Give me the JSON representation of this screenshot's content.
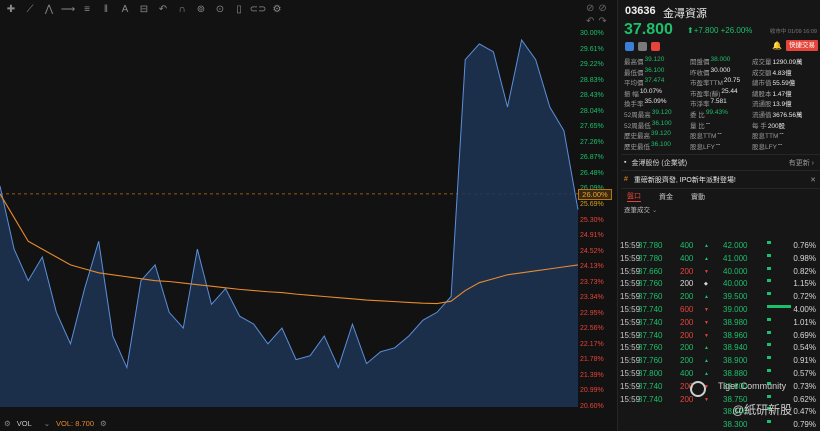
{
  "chart": {
    "y_ticks": [
      "30.00%",
      "29.61%",
      "29.22%",
      "28.83%",
      "28.43%",
      "28.04%",
      "27.65%",
      "27.26%",
      "26.87%",
      "26.48%",
      "26.09%",
      "25.69%",
      "25.30%",
      "24.91%",
      "24.52%",
      "24.13%",
      "23.73%",
      "23.34%",
      "22.95%",
      "22.56%",
      "22.17%",
      "21.78%",
      "21.39%",
      "20.99%",
      "20.60%"
    ],
    "prev_close_tag": "26.00%",
    "vol_label": "VOL",
    "vol_value": "VOL: 8.700",
    "price_line_color": "#5b8fd9",
    "avg_line_color": "#e88a2e"
  },
  "chart_data": {
    "type": "line",
    "series": [
      {
        "name": "",
        "color": "#5b8fd9",
        "values": [
          26.2,
          24.6,
          23.8,
          24.4,
          23.0,
          22.2,
          23.6,
          24.8,
          22.4,
          21.6,
          23.8,
          24.2,
          23.0,
          22.6,
          24.6,
          23.2,
          23.6,
          22.9,
          22.7,
          22.2,
          22.6,
          21.8,
          21.9,
          22.4,
          21.6,
          22.7,
          21.7,
          22.0,
          22.1,
          22.4,
          22.8,
          23.0,
          23.4,
          29.4,
          29.8,
          29.6,
          28.2,
          29.9,
          29.4,
          28.2,
          27.6,
          25.6
        ]
      },
      {
        "name": "",
        "color": "#e88a2e",
        "values": [
          26.0,
          25.4,
          24.8,
          24.6,
          24.4,
          24.2,
          24.1,
          24.0,
          23.95,
          23.9,
          23.85,
          23.8,
          23.78,
          23.74,
          23.7,
          23.66,
          23.62,
          23.58,
          23.55,
          23.52,
          23.5,
          23.46,
          23.43,
          23.4,
          23.37,
          23.34,
          23.31,
          23.29,
          23.27,
          23.25,
          23.23,
          23.22,
          23.28,
          23.55,
          23.75,
          23.85,
          23.95,
          24.0,
          24.05,
          24.1,
          24.15,
          24.2
        ]
      }
    ],
    "ylim": [
      20.6,
      30.0
    ],
    "reference_line": 26.0
  },
  "stock": {
    "code": "03636",
    "name": "金潯資源",
    "price": "37.800",
    "change": "+7.800 +26.00%",
    "time": "收市中 01/09 16:09"
  },
  "fast_trade": "快捷交易",
  "stats": [
    [
      [
        "最高價",
        "39.120",
        "g"
      ],
      [
        "開盤價",
        "38.000",
        "g"
      ],
      [
        "成交量",
        "1290.09萬",
        "w"
      ]
    ],
    [
      [
        "最低價",
        "36.100",
        "g"
      ],
      [
        "昨收價",
        "30.000",
        "w"
      ],
      [
        "成交額",
        "4.83億",
        "w"
      ]
    ],
    [
      [
        "平均價",
        "37.474",
        "g"
      ],
      [
        "市盈率TTM",
        "20.75",
        "w"
      ],
      [
        "總市值",
        "55.59億",
        "w"
      ]
    ],
    [
      [
        "振    幅",
        "10.07%",
        "w"
      ],
      [
        "市盈率(靜)",
        "25.44",
        "w"
      ],
      [
        "總股本",
        "1.47億",
        "w"
      ]
    ],
    [
      [
        "換手率",
        "35.09%",
        "w"
      ],
      [
        "市淨率",
        "7.581",
        "w"
      ],
      [
        "流通股",
        "13.9億",
        "w"
      ]
    ],
    [
      [
        "52周最高",
        "39.120",
        "g"
      ],
      [
        "委    比",
        "99.43%",
        "g"
      ],
      [
        "流通值",
        "3676.56萬",
        "w"
      ]
    ],
    [
      [
        "52周最低",
        "36.100",
        "g"
      ],
      [
        "量    比",
        "--",
        "w"
      ],
      [
        "每    手",
        "200股",
        "w"
      ]
    ],
    [
      [
        "歷史最高",
        "39.120",
        "g"
      ],
      [
        "股息TTM",
        "--",
        "w"
      ],
      [
        "股息TTM",
        "--",
        "w"
      ]
    ],
    [
      [
        "歷史最低",
        "36.100",
        "g"
      ],
      [
        "股息LFY",
        "--",
        "w"
      ],
      [
        "股息LFY",
        "--",
        "w"
      ]
    ]
  ],
  "company": {
    "label": "金潯股份 (企業號)",
    "more": "有更新"
  },
  "news": {
    "text": "重磅新股齊發, IPO新年派對登場!"
  },
  "tabs": [
    "盤口",
    "資金",
    "實動"
  ],
  "trades_title": "逐筆成交",
  "trades": [
    [
      "15:59",
      "37.780",
      "400",
      "up"
    ],
    [
      "15:59",
      "37.780",
      "400",
      "up"
    ],
    [
      "15:59",
      "37.660",
      "200",
      "down"
    ],
    [
      "15:59",
      "37.760",
      "200",
      "dot"
    ],
    [
      "15:59",
      "37.760",
      "200",
      "up"
    ],
    [
      "15:59",
      "37.740",
      "600",
      "down"
    ],
    [
      "15:59",
      "37.740",
      "200",
      "down"
    ],
    [
      "15:59",
      "37.740",
      "200",
      "down"
    ],
    [
      "15:59",
      "37.760",
      "200",
      "up"
    ],
    [
      "15:59",
      "37.760",
      "200",
      "up"
    ],
    [
      "15:59",
      "37.800",
      "400",
      "up"
    ],
    [
      "15:59",
      "37.740",
      "200",
      "down"
    ],
    [
      "15:59",
      "37.740",
      "200",
      "down"
    ]
  ],
  "depth": [
    [
      "42.000",
      "0.76%",
      0
    ],
    [
      "41.000",
      "0.98%",
      0
    ],
    [
      "40.000",
      "0.82%",
      0
    ],
    [
      "40.000",
      "1.15%",
      0
    ],
    [
      "39.500",
      "0.72%",
      0
    ],
    [
      "39.000",
      "4.00%",
      1
    ],
    [
      "38.980",
      "1.01%",
      0
    ],
    [
      "38.960",
      "0.69%",
      0
    ],
    [
      "38.940",
      "0.54%",
      0
    ],
    [
      "38.900",
      "0.91%",
      0
    ],
    [
      "38.880",
      "0.57%",
      0
    ],
    [
      "38.800",
      "0.73%",
      0
    ],
    [
      "38.750",
      "0.62%",
      0
    ],
    [
      "38.500",
      "0.47%",
      0
    ],
    [
      "38.300",
      "0.79%",
      0
    ]
  ],
  "watermark": {
    "line1": "Tiger Community",
    "line2": "@紙研新股"
  }
}
